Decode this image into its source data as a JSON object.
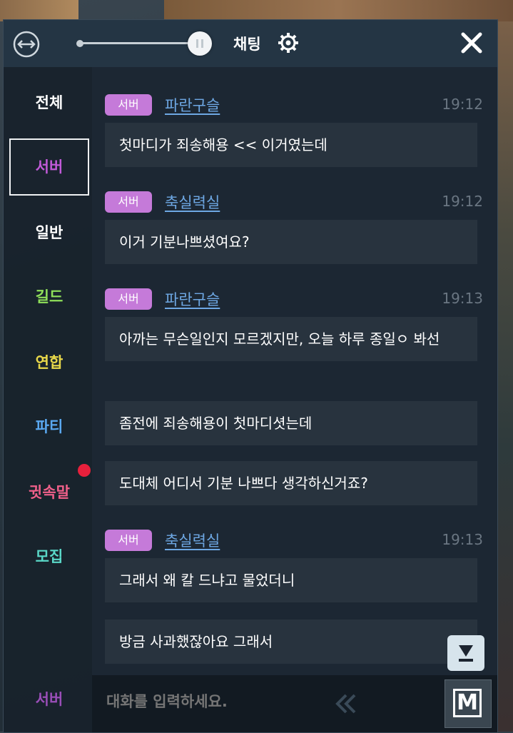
{
  "header": {
    "title": "채팅"
  },
  "sidebar": {
    "tabs": [
      {
        "label": "전체",
        "color": "#ffffff"
      },
      {
        "label": "서버",
        "color": "#c15ad8",
        "active": true
      },
      {
        "label": "일반",
        "color": "#ffffff"
      },
      {
        "label": "길드",
        "color": "#8fe05a"
      },
      {
        "label": "연합",
        "color": "#e8d84a"
      },
      {
        "label": "파티",
        "color": "#5aa8f0"
      },
      {
        "label": "귓속말",
        "color": "#f0608a"
      },
      {
        "label": "모집",
        "color": "#5ad8c8"
      }
    ],
    "channel_label": "서버"
  },
  "messages": [
    {
      "badge": "서버",
      "name": "파란구슬",
      "time": "19:12",
      "text": "첫마디가 죄송해용 << 이거였는데"
    },
    {
      "badge": "서버",
      "name": "축실력실",
      "time": "19:12",
      "text": "이거 기분나쁘셨여요?"
    },
    {
      "badge": "서버",
      "name": "파란구슬",
      "time": "19:13",
      "text": "아까는 무슨일인지 모르겠지만, 오늘 하루 종일ㅇ 봐선"
    },
    {
      "text": "좀전에 죄송해용이 첫마디셧는데"
    },
    {
      "text": "도대체 어디서 기분 나쁘다 생각하신거죠?"
    },
    {
      "badge": "서버",
      "name": "축실력실",
      "time": "19:13",
      "text": "그래서 왜 칼 드냐고 물었더니"
    },
    {
      "text": "방금 사과했잖아요 그래서"
    }
  ],
  "input": {
    "placeholder": "대화를 입력하세요."
  },
  "mode_button": {
    "label": "M"
  }
}
